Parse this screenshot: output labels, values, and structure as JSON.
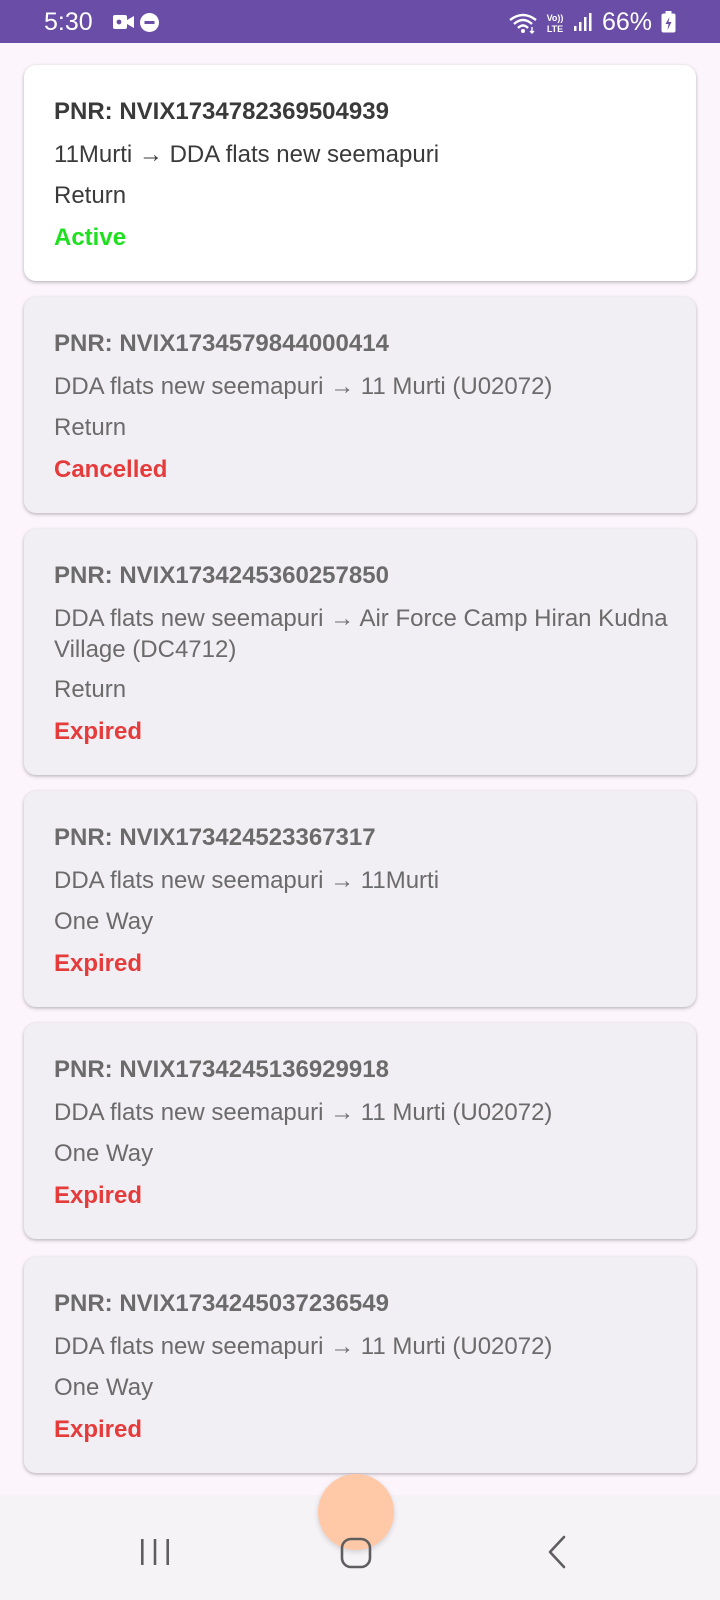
{
  "status_bar": {
    "time": "5:30",
    "battery": "66%",
    "icons": [
      "video-camera-icon",
      "do-not-disturb-icon",
      "wifi-icon",
      "volte-icon",
      "signal-icon",
      "battery-icon"
    ]
  },
  "tickets": [
    {
      "pnr": "PNR: NVIX1734782369504939",
      "route": "11Murti →  DDA flats new seemapuri",
      "trip": "Return",
      "status": "Active"
    },
    {
      "pnr": "PNR: NVIX1734579844000414",
      "route": " DDA flats new seemapuri → 11 Murti (U02072)",
      "trip": "Return",
      "status": "Cancelled"
    },
    {
      "pnr": "PNR: NVIX1734245360257850",
      "route": " DDA flats new seemapuri → Air Force Camp Hiran Kudna Village (DC4712)",
      "trip": "Return",
      "status": "Expired"
    },
    {
      "pnr": "PNR: NVIX173424523367317",
      "route": " DDA flats new seemapuri → 11Murti",
      "trip": "One Way",
      "status": "Expired"
    },
    {
      "pnr": "PNR: NVIX1734245136929918",
      "route": " DDA flats new seemapuri → 11 Murti (U02072)",
      "trip": "One Way",
      "status": "Expired"
    },
    {
      "pnr": "PNR: NVIX1734245037236549",
      "route": " DDA flats new seemapuri → 11 Murti (U02072)",
      "trip": "One Way",
      "status": "Expired"
    }
  ],
  "colors": {
    "status_bar": "#6a4da6",
    "active": "#1fe01f",
    "cancelled": "#e53b3b",
    "expired": "#e53b3b",
    "page_background": "#fcf5fc"
  },
  "nav_bar": {
    "icons": [
      "recent-apps-icon",
      "home-icon",
      "back-icon"
    ]
  }
}
